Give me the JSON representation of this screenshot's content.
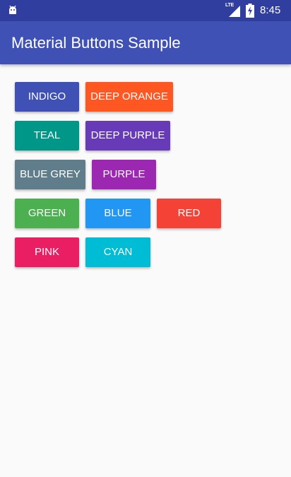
{
  "status_bar": {
    "time": "8:45",
    "network_type": "LTE",
    "background_color": "#303f9f",
    "icons": [
      "android-icon",
      "lte-icon",
      "signal-icon",
      "battery-icon"
    ]
  },
  "app_bar": {
    "title": "Material Buttons Sample",
    "background_color": "#3f51b5"
  },
  "buttons": [
    {
      "label": "INDIGO",
      "color": "#3f51b5"
    },
    {
      "label": "DEEP ORANGE",
      "color": "#ff5722"
    },
    {
      "label": "TEAL",
      "color": "#009688"
    },
    {
      "label": "DEEP PURPLE",
      "color": "#673ab7"
    },
    {
      "label": "BLUE GREY",
      "color": "#607d8b"
    },
    {
      "label": "PURPLE",
      "color": "#9c27b0"
    },
    {
      "label": "GREEN",
      "color": "#4caf50"
    },
    {
      "label": "BLUE",
      "color": "#2196f3"
    },
    {
      "label": "RED",
      "color": "#f44336"
    },
    {
      "label": "PINK",
      "color": "#e91e63"
    },
    {
      "label": "CYAN",
      "color": "#00bcd4"
    }
  ]
}
